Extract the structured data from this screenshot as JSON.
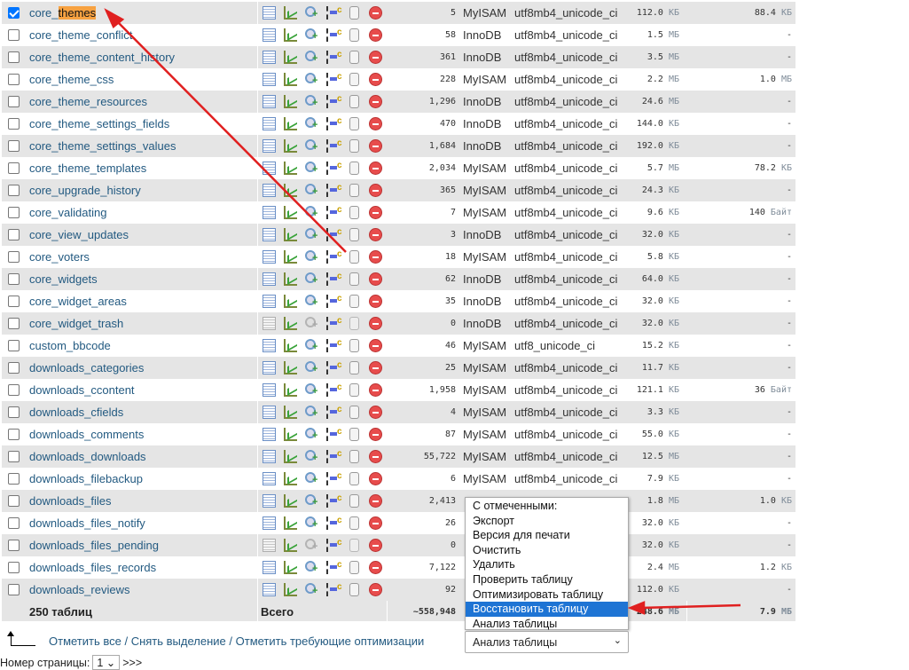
{
  "rows": [
    {
      "name": "core_themes",
      "highlight": "themes",
      "rows": "5",
      "engine": "MyISAM",
      "collation": "utf8mb4_unicode_ci",
      "size": "112.0",
      "size_unit": "КБ",
      "overhead": "88.4",
      "overhead_unit": "КБ",
      "checked": true
    },
    {
      "name": "core_theme_conflict",
      "rows": "58",
      "engine": "InnoDB",
      "collation": "utf8mb4_unicode_ci",
      "size": "1.5",
      "size_unit": "МБ",
      "overhead": "-"
    },
    {
      "name": "core_theme_content_history",
      "rows": "361",
      "engine": "InnoDB",
      "collation": "utf8mb4_unicode_ci",
      "size": "3.5",
      "size_unit": "МБ",
      "overhead": "-"
    },
    {
      "name": "core_theme_css",
      "rows": "228",
      "engine": "MyISAM",
      "collation": "utf8mb4_unicode_ci",
      "size": "2.2",
      "size_unit": "МБ",
      "overhead": "1.0",
      "overhead_unit": "МБ"
    },
    {
      "name": "core_theme_resources",
      "rows": "1,296",
      "engine": "InnoDB",
      "collation": "utf8mb4_unicode_ci",
      "size": "24.6",
      "size_unit": "МБ",
      "overhead": "-"
    },
    {
      "name": "core_theme_settings_fields",
      "rows": "470",
      "engine": "InnoDB",
      "collation": "utf8mb4_unicode_ci",
      "size": "144.0",
      "size_unit": "КБ",
      "overhead": "-"
    },
    {
      "name": "core_theme_settings_values",
      "rows": "1,684",
      "engine": "InnoDB",
      "collation": "utf8mb4_unicode_ci",
      "size": "192.0",
      "size_unit": "КБ",
      "overhead": "-"
    },
    {
      "name": "core_theme_templates",
      "rows": "2,034",
      "engine": "MyISAM",
      "collation": "utf8mb4_unicode_ci",
      "size": "5.7",
      "size_unit": "МБ",
      "overhead": "78.2",
      "overhead_unit": "КБ"
    },
    {
      "name": "core_upgrade_history",
      "rows": "365",
      "engine": "MyISAM",
      "collation": "utf8mb4_unicode_ci",
      "size": "24.3",
      "size_unit": "КБ",
      "overhead": "-"
    },
    {
      "name": "core_validating",
      "rows": "7",
      "engine": "MyISAM",
      "collation": "utf8mb4_unicode_ci",
      "size": "9.6",
      "size_unit": "КБ",
      "overhead": "140",
      "overhead_unit": "Байт"
    },
    {
      "name": "core_view_updates",
      "rows": "3",
      "engine": "InnoDB",
      "collation": "utf8mb4_unicode_ci",
      "size": "32.0",
      "size_unit": "КБ",
      "overhead": "-"
    },
    {
      "name": "core_voters",
      "rows": "18",
      "engine": "MyISAM",
      "collation": "utf8mb4_unicode_ci",
      "size": "5.8",
      "size_unit": "КБ",
      "overhead": "-"
    },
    {
      "name": "core_widgets",
      "rows": "62",
      "engine": "InnoDB",
      "collation": "utf8mb4_unicode_ci",
      "size": "64.0",
      "size_unit": "КБ",
      "overhead": "-"
    },
    {
      "name": "core_widget_areas",
      "rows": "35",
      "engine": "InnoDB",
      "collation": "utf8mb4_unicode_ci",
      "size": "32.0",
      "size_unit": "КБ",
      "overhead": "-"
    },
    {
      "name": "core_widget_trash",
      "rows": "0",
      "engine": "InnoDB",
      "collation": "utf8mb4_unicode_ci",
      "size": "32.0",
      "size_unit": "КБ",
      "overhead": "-",
      "empty": true
    },
    {
      "name": "custom_bbcode",
      "rows": "46",
      "engine": "MyISAM",
      "collation": "utf8_unicode_ci",
      "size": "15.2",
      "size_unit": "КБ",
      "overhead": "-"
    },
    {
      "name": "downloads_categories",
      "rows": "25",
      "engine": "MyISAM",
      "collation": "utf8mb4_unicode_ci",
      "size": "11.7",
      "size_unit": "КБ",
      "overhead": "-"
    },
    {
      "name": "downloads_ccontent",
      "rows": "1,958",
      "engine": "MyISAM",
      "collation": "utf8mb4_unicode_ci",
      "size": "121.1",
      "size_unit": "КБ",
      "overhead": "36",
      "overhead_unit": "Байт"
    },
    {
      "name": "downloads_cfields",
      "rows": "4",
      "engine": "MyISAM",
      "collation": "utf8mb4_unicode_ci",
      "size": "3.3",
      "size_unit": "КБ",
      "overhead": "-"
    },
    {
      "name": "downloads_comments",
      "rows": "87",
      "engine": "MyISAM",
      "collation": "utf8mb4_unicode_ci",
      "size": "55.0",
      "size_unit": "КБ",
      "overhead": "-"
    },
    {
      "name": "downloads_downloads",
      "rows": "55,722",
      "engine": "MyISAM",
      "collation": "utf8mb4_unicode_ci",
      "size": "12.5",
      "size_unit": "МБ",
      "overhead": "-"
    },
    {
      "name": "downloads_filebackup",
      "rows": "6",
      "engine": "MyISAM",
      "collation": "utf8mb4_unicode_ci",
      "size": "7.9",
      "size_unit": "КБ",
      "overhead": "-"
    },
    {
      "name": "downloads_files",
      "rows": "2,413",
      "size": "1.8",
      "size_unit": "МБ",
      "overhead": "1.0",
      "overhead_unit": "КБ"
    },
    {
      "name": "downloads_files_notify",
      "rows": "26",
      "size": "32.0",
      "size_unit": "КБ",
      "overhead": "-"
    },
    {
      "name": "downloads_files_pending",
      "rows": "0",
      "size": "32.0",
      "size_unit": "КБ",
      "overhead": "-",
      "empty": true
    },
    {
      "name": "downloads_files_records",
      "rows": "7,122",
      "size": "2.4",
      "size_unit": "МБ",
      "overhead": "1.2",
      "overhead_unit": "КБ"
    },
    {
      "name": "downloads_reviews",
      "rows": "92",
      "size": "112.0",
      "size_unit": "КБ",
      "overhead": "-"
    }
  ],
  "footer": {
    "tables": "250 таблиц",
    "total": "Всего",
    "rows": "~558,948",
    "size": "248.6",
    "size_unit": "МБ",
    "overhead": "7.9",
    "overhead_unit": "МБ"
  },
  "menu": {
    "items": [
      "С отмеченными:",
      "Экспорт",
      "Версия для печати",
      "Очистить",
      "Удалить",
      "Проверить таблицу",
      "Оптимизировать таблицу",
      "Восстановить таблицу",
      "Анализ таблицы"
    ],
    "selected_index": 7
  },
  "select": {
    "value": "Анализ таблицы"
  },
  "links": {
    "check_all": "Отметить все",
    "uncheck_all": "Снять выделение",
    "check_overhead": "Отметить требующие оптимизации",
    "sep": " / "
  },
  "pager": {
    "label": "Номер страницы:",
    "value": "1",
    "next": ">>>"
  },
  "colors": {
    "row_alt": "#e5e5e5",
    "link": "#235a81",
    "highlight": "#f7a241",
    "menu_selected": "#1e74d4",
    "annotation_arrow": "#e02020"
  }
}
